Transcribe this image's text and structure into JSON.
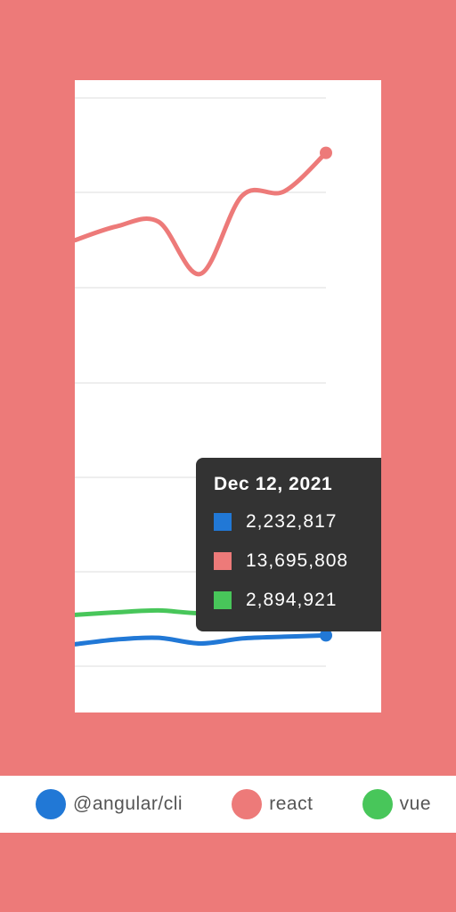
{
  "chart_data": {
    "type": "line",
    "series": [
      {
        "name": "@angular/cli",
        "color": "#2178d6",
        "values": [
          2020000,
          2135000,
          2175000,
          2040000,
          2160000,
          2200000,
          2232817
        ]
      },
      {
        "name": "react",
        "color": "#ed7a79",
        "values": [
          11620000,
          11950000,
          12060000,
          10820000,
          12680000,
          12780000,
          13695808
        ]
      },
      {
        "name": "vue",
        "color": "#48c65a",
        "values": [
          2720000,
          2780000,
          2825000,
          2760000,
          2870000,
          2880000,
          2894921
        ]
      }
    ],
    "ylim": [
      1500000,
      15000000
    ],
    "grid": true,
    "legend": "bottom"
  },
  "tooltip": {
    "title": "Dec 12, 2021",
    "rows": [
      {
        "value": "2,232,817",
        "color": "#2178d6"
      },
      {
        "value": "13,695,808",
        "color": "#ed7a79"
      },
      {
        "value": "2,894,921",
        "color": "#48c65a"
      }
    ]
  },
  "legend": {
    "items": [
      {
        "label": "@angular/cli",
        "color": "#2178d6"
      },
      {
        "label": "react",
        "color": "#ed7a79"
      },
      {
        "label": "vue",
        "color": "#48c65a"
      }
    ]
  }
}
